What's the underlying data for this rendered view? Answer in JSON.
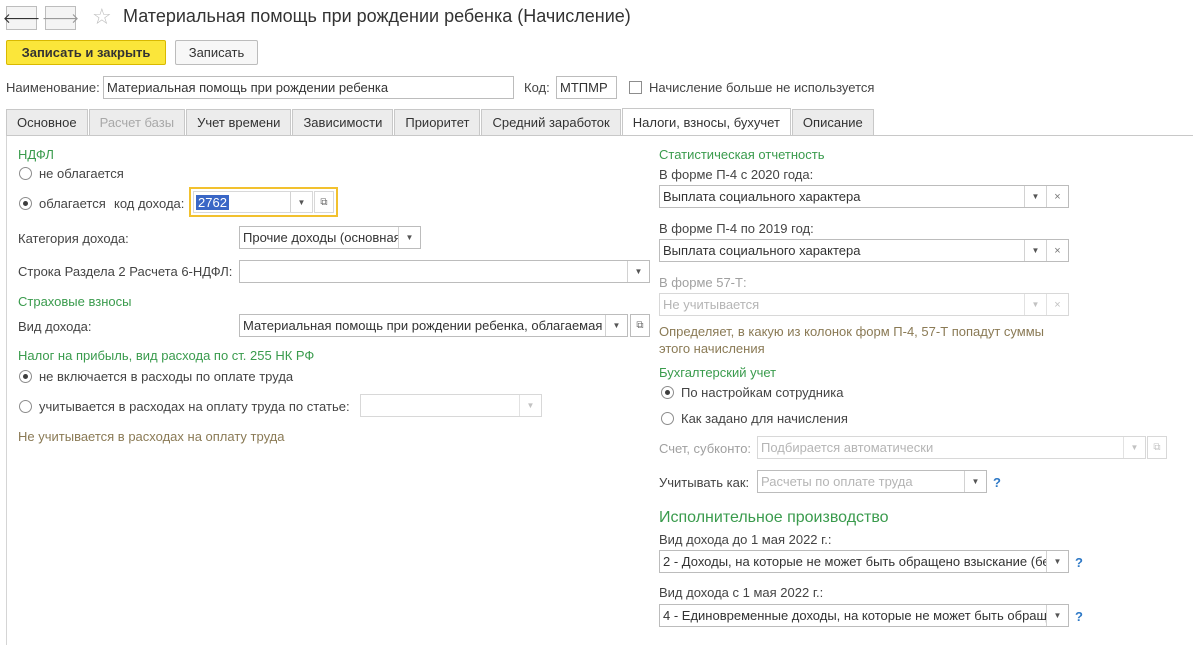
{
  "header": {
    "back_glyph": "🡐",
    "forward_glyph": "🡒",
    "star_glyph": "☆",
    "title": "Материальная помощь при рождении ребенка (Начисление)"
  },
  "toolbar": {
    "save_close_label": "Записать и закрыть",
    "save_label": "Записать"
  },
  "top_fields": {
    "name_label": "Наименование:",
    "name_value": "Материальная помощь при рождении ребенка",
    "code_label": "Код:",
    "code_value": "МТПМР",
    "unused_label": "Начисление больше не используется"
  },
  "tabs": [
    {
      "label": "Основное"
    },
    {
      "label": "Расчет базы"
    },
    {
      "label": "Учет времени"
    },
    {
      "label": "Зависимости"
    },
    {
      "label": "Приоритет"
    },
    {
      "label": "Средний заработок"
    },
    {
      "label": "Налоги, взносы, бухучет"
    },
    {
      "label": "Описание"
    }
  ],
  "ndfl": {
    "title": "НДФЛ",
    "not_taxed": "не облагается",
    "taxed": "облагается",
    "income_code_label": "код дохода:",
    "income_code_value": "2762",
    "income_category_label": "Категория дохода:",
    "income_category_value": "Прочие доходы (основная",
    "row_6ndfl_label": "Строка Раздела 2 Расчета 6-НДФЛ:",
    "row_6ndfl_value": ""
  },
  "insurance": {
    "title": "Страховые взносы",
    "income_type_label": "Вид дохода:",
    "income_type_value": "Материальная помощь при рождении ребенка, облагаемая"
  },
  "profit_tax": {
    "title": "Налог на прибыль, вид расхода по ст. 255 НК РФ",
    "not_included": "не включается в расходы по оплате труда",
    "included_by_article": "учитывается в расходах на оплату труда по статье:",
    "article_value": "",
    "note": "Не учитывается в расходах на оплату труда"
  },
  "statistics": {
    "title": "Статистическая отчетность",
    "p4_2020_label": "В форме П-4 с 2020 года:",
    "p4_2020_value": "Выплата социального характера",
    "p4_2019_label": "В форме П-4 по 2019 год:",
    "p4_2019_value": "Выплата социального характера",
    "f57t_label": "В форме 57-Т:",
    "f57t_value": "Не учитывается",
    "note_line1": "Определяет, в какую из колонок форм П-4, 57-Т попадут суммы",
    "note_line2": "этого начисления"
  },
  "accounting": {
    "title": "Бухгалтерский учет",
    "by_employee": "По настройкам сотрудника",
    "as_set": "Как задано для начисления",
    "account_label": "Счет, субконто:",
    "account_value": "Подбирается автоматически",
    "account_as_label": "Учитывать как:",
    "account_as_value": "Расчеты по оплате труда",
    "help_glyph": "?"
  },
  "enforcement": {
    "title": "Исполнительное производство",
    "before_label": "Вид дохода до 1 мая 2022 г.:",
    "before_value": "2 - Доходы, на которые не может быть обращено взыскание (бе",
    "after_label": "Вид дохода с 1 мая 2022 г.:",
    "after_value": "4 - Единовременные доходы, на которые не может быть обращ",
    "help_glyph": "?"
  },
  "icons": {
    "dropdown": "▼",
    "clear": "×",
    "open": "⧉"
  },
  "colors": {
    "primary_button": "#fbe63a",
    "section_title": "#3a9b4d",
    "focus_border": "#f2c12e",
    "selection": "#3a67c6",
    "help": "#2f79c6"
  }
}
